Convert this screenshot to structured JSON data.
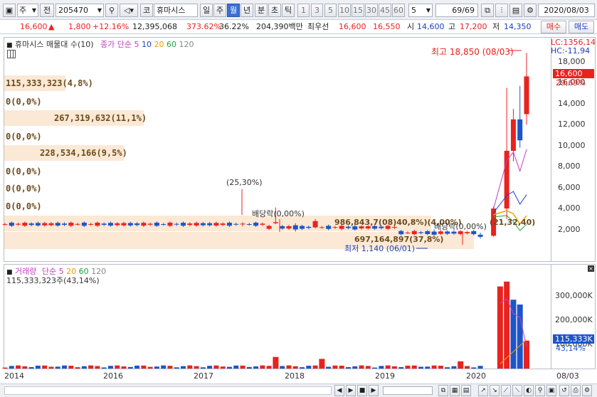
{
  "toolbar": {
    "type_select": "주",
    "prev_label": "전",
    "code": "205470",
    "mode_label": "코",
    "stock_name": "휴마시스",
    "periods": [
      "일",
      "주",
      "월",
      "년",
      "분",
      "초",
      "틱"
    ],
    "active_period": "월",
    "intervals": [
      "1",
      "3",
      "5",
      "10",
      "15",
      "30",
      "45",
      "60"
    ],
    "interval_value": "5",
    "page": "69/69",
    "date": "2020/08/03"
  },
  "pricebar": {
    "price": "16,600",
    "change": "1,800",
    "change_pct": "+12.16%",
    "volume": "12,395,068",
    "vol_ratio": "373.62%",
    "turnover": "36.22%",
    "amount": "204,390백만",
    "best_label": "최우선",
    "ask": "16,600",
    "bid": "16,550",
    "open_label": "시",
    "open": "14,600",
    "high_label": "고",
    "high": "17,200",
    "low_label": "저",
    "low": "14,350",
    "buy_label": "매수",
    "sell_label": "매도"
  },
  "price_panel": {
    "title": "휴마시스 매물대 수(10)",
    "ma_label": "종가 단순",
    "ma_periods": [
      "5",
      "10",
      "20",
      "60",
      "120"
    ],
    "ma_colors": [
      "#c040c0",
      "#2040d0",
      "#f0a000",
      "#20a040",
      "#888888"
    ],
    "lc_label": "LC:1356,14",
    "hc_label": "HC:-11,94",
    "price_tag": "16,600",
    "pct_tag": "29,69%",
    "max_label": "최고 18,850 (08/03)",
    "min_label": "최저 1,140 (06/01)",
    "annot_pct": "(25,30%)",
    "annot_div1": "배당락(0,00%)",
    "annot_div2": "배당락(0,00%)",
    "overlap_text1": "986,843,7(08)40,8%)(4,00%)",
    "overlap_text2": "697,164,897(37,8%)",
    "overlap_text3": "(21,32,40)",
    "volume_profile": [
      {
        "label": "115,333,323(4,8%)",
        "boxed": true
      },
      {
        "label": "0(0,0%)",
        "boxed": false
      },
      {
        "label": "267,319,632(11,1%)",
        "boxed": true
      },
      {
        "label": "0(0,0%)",
        "boxed": false
      },
      {
        "label": "228,534,166(9,5%)",
        "boxed": true
      },
      {
        "label": "0(0,0%)",
        "boxed": false
      },
      {
        "label": "0(0,0%)",
        "boxed": false
      },
      {
        "label": "0(0,0%)",
        "boxed": false
      }
    ],
    "y_ticks": [
      "18,000",
      "16,000",
      "14,000",
      "12,000",
      "10,000",
      "8,000",
      "6,000",
      "4,000",
      "2,000"
    ]
  },
  "volume_panel": {
    "title": "거래량",
    "ma_label": "단순",
    "ma_periods": [
      "5",
      "20",
      "60",
      "120"
    ],
    "sub_label": "115,333,323주(43,14%)",
    "y_ticks": [
      "300,000K",
      "200,000K",
      "100,000K"
    ],
    "vol_tag": "115,333K",
    "vol_pct": "43,14%"
  },
  "x_axis": {
    "labels": [
      "2014",
      "2016",
      "2017",
      "2018",
      "2019",
      "2020"
    ],
    "right_label": "08/03"
  },
  "chart_data": {
    "type": "candlestick",
    "price_series": [
      {
        "date": "2017-01",
        "open": 2500,
        "high": 2700,
        "low": 2300,
        "close": 2550
      },
      {
        "date": "2017-06",
        "open": 2600,
        "high": 4100,
        "low": 2500,
        "close": 2700
      },
      {
        "date": "2017-09",
        "open": 2400,
        "high": 2600,
        "low": 1800,
        "close": 2000
      },
      {
        "date": "2017-12",
        "open": 2200,
        "high": 3000,
        "low": 2100,
        "close": 2800
      },
      {
        "date": "2018-06",
        "open": 2300,
        "high": 2500,
        "low": 1900,
        "close": 2000
      },
      {
        "date": "2019-06",
        "open": 1800,
        "high": 2000,
        "low": 1400,
        "close": 1500
      },
      {
        "date": "2020-01",
        "open": 1500,
        "high": 1700,
        "low": 1140,
        "close": 1300
      },
      {
        "date": "2020-03",
        "open": 1400,
        "high": 4200,
        "low": 1300,
        "close": 4000
      },
      {
        "date": "2020-05",
        "open": 4000,
        "high": 15500,
        "low": 3000,
        "close": 9500
      },
      {
        "date": "2020-06",
        "open": 9500,
        "high": 13500,
        "low": 8500,
        "close": 12500
      },
      {
        "date": "2020-07",
        "open": 12500,
        "high": 15700,
        "low": 9800,
        "close": 10500
      },
      {
        "date": "2020-08",
        "open": 13000,
        "high": 18850,
        "low": 12000,
        "close": 16600
      }
    ],
    "volume_series": [
      {
        "date": "2017-06",
        "value": 48000,
        "up": true
      },
      {
        "date": "2018-01",
        "value": 40000,
        "up": true
      },
      {
        "date": "2019-10",
        "value": 30000,
        "up": true
      },
      {
        "date": "2020-04",
        "value": 340000,
        "up": true
      },
      {
        "date": "2020-05",
        "value": 360000,
        "up": true
      },
      {
        "date": "2020-06",
        "value": 285000,
        "up": false
      },
      {
        "date": "2020-07",
        "value": 265000,
        "up": false
      },
      {
        "date": "2020-08",
        "value": 115333,
        "up": true
      }
    ],
    "ylim_price": [
      0,
      19000
    ],
    "ylim_volume": [
      0,
      380000
    ]
  }
}
